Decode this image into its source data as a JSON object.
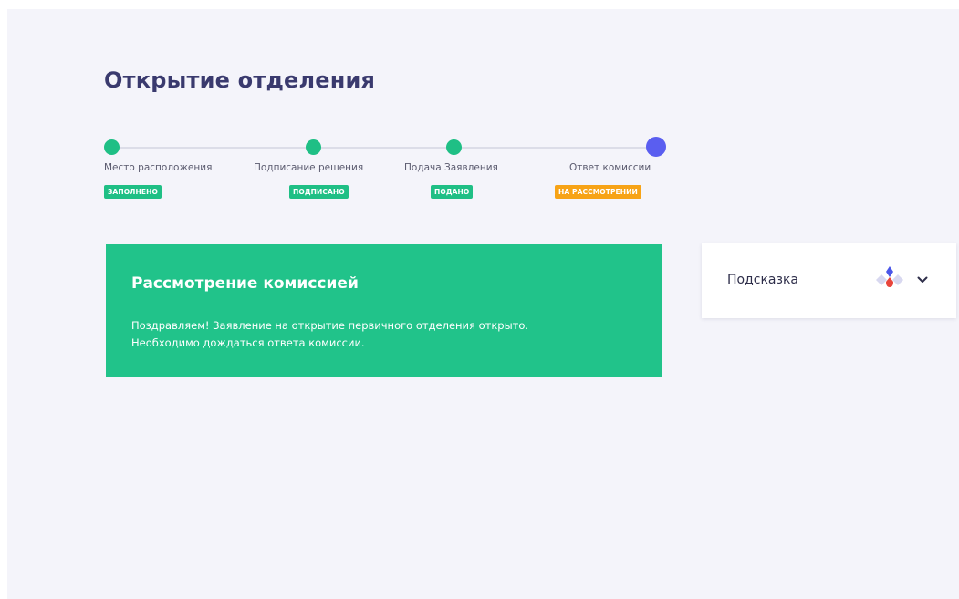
{
  "header": {
    "title": "Открытие отделения"
  },
  "steps": [
    {
      "label": "Место расположения",
      "status": "ЗАПОЛНЕНО",
      "state": "done"
    },
    {
      "label": "Подписание решения",
      "status": "ПОДПИСАНО",
      "state": "done"
    },
    {
      "label": "Подача Заявления",
      "status": "ПОДАНО",
      "state": "done"
    },
    {
      "label": "Ответ комиссии",
      "status": "НА РАССМОТРЕНИИ",
      "state": "active"
    }
  ],
  "banner": {
    "title": "Рассмотрение комиссией",
    "line1": "Поздравляем! Заявление на открытие первичного отделения открыто.",
    "line2": "Необходимо дождаться ответа комиссии."
  },
  "hint": {
    "label": "Подсказка",
    "icon": "hint-diamond-icon",
    "chevron_icon": "chevron-down-icon"
  },
  "colors": {
    "accent_green": "#21c38a",
    "accent_blue": "#5a5ef0",
    "pending_orange": "#f7a316",
    "title_color": "#3a3a6e",
    "background": "#f4f4fa"
  }
}
